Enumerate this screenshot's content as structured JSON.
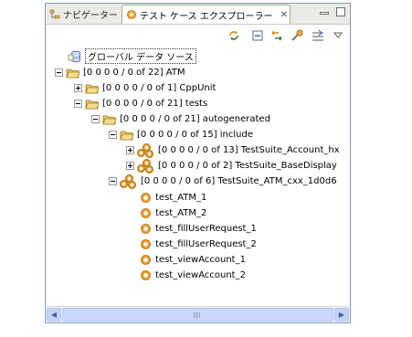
{
  "tabs": [
    {
      "label": "ナビゲーター",
      "active": false
    },
    {
      "label": "テスト ケース エクスプローラー",
      "active": true,
      "close": "✕"
    }
  ],
  "toolbar": {
    "icons": [
      "refresh-icon",
      "collapse-all-icon",
      "link-editor-icon",
      "run-icon",
      "filter-icon",
      "view-menu-icon"
    ]
  },
  "tree": {
    "root_label": "グローバル データ ソース",
    "atm": "[0 0 0 0 / 0 of 22] ATM",
    "cppunit": "[0 0 0 0 / 0 of 1] CppUnit",
    "tests": "[0 0 0 0 / 0 of 21] tests",
    "autogenerated": "[0 0 0 0 / 0 of 21] autogenerated",
    "include": "[0 0 0 0 / 0 of 15] include",
    "suite_account": "[0 0 0 0 / 0 of 13] TestSuite_Account_hx",
    "suite_basedisplay": "[0 0 0 0 / 0 of 2] TestSuite_BaseDisplay",
    "suite_atm": "[0 0 0 0 / 0 of 6] TestSuite_ATM_cxx_1d0d6",
    "cases": [
      "test_ATM_1",
      "test_ATM_2",
      "test_fillUserRequest_1",
      "test_fillUserRequest_2",
      "test_viewAccount_1",
      "test_viewAccount_2"
    ]
  },
  "colors": {
    "folder": "#e9c46a",
    "accent_border": "#7f9db9",
    "scroll": "#c1d3fb"
  }
}
